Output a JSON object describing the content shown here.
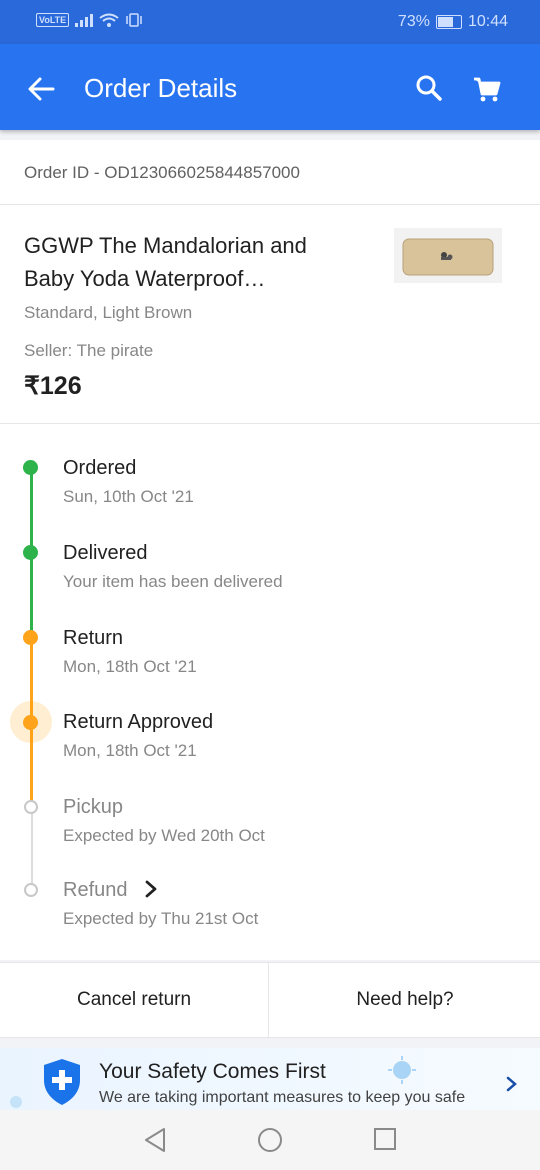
{
  "status_bar": {
    "network_badge": "VoLTE",
    "battery": "73%",
    "battery_level": 0.73,
    "time": "10:44"
  },
  "app_bar": {
    "title": "Order Details",
    "icons": [
      "back-arrow-icon",
      "search-icon",
      "cart-icon"
    ]
  },
  "order": {
    "id_text": "Order ID - OD123066025844857000"
  },
  "product": {
    "title": "GGWP The Mandalorian and Baby Yoda Waterproof…",
    "variant": "Standard, Light Brown",
    "seller": "Seller: The pirate",
    "price": "₹126"
  },
  "timeline": {
    "steps": [
      {
        "title": "Ordered",
        "subtitle": "Sun, 10th Oct '21",
        "state": "done-green"
      },
      {
        "title": "Delivered",
        "subtitle": "Your item has been delivered",
        "state": "done-green"
      },
      {
        "title": "Return",
        "subtitle": "Mon, 18th Oct '21",
        "state": "done-orange"
      },
      {
        "title": "Return Approved",
        "subtitle": "Mon, 18th Oct '21",
        "state": "current-orange"
      },
      {
        "title": "Pickup",
        "subtitle": "Expected by Wed 20th Oct",
        "state": "pending"
      },
      {
        "title": "Refund",
        "subtitle": "Expected by Thu 21st Oct",
        "state": "pending"
      }
    ],
    "colors": {
      "green": "#2db34a",
      "orange": "#ffa31a",
      "pending": "#c8c8c8"
    }
  },
  "actions": {
    "cancel_label": "Cancel return",
    "help_label": "Need help?"
  },
  "banner": {
    "title": "Your Safety Comes First",
    "subtitle": "We are taking important measures to keep you safe"
  },
  "colors": {
    "brand_blue": "#2874f0",
    "status_bar": "#2a69d9"
  }
}
